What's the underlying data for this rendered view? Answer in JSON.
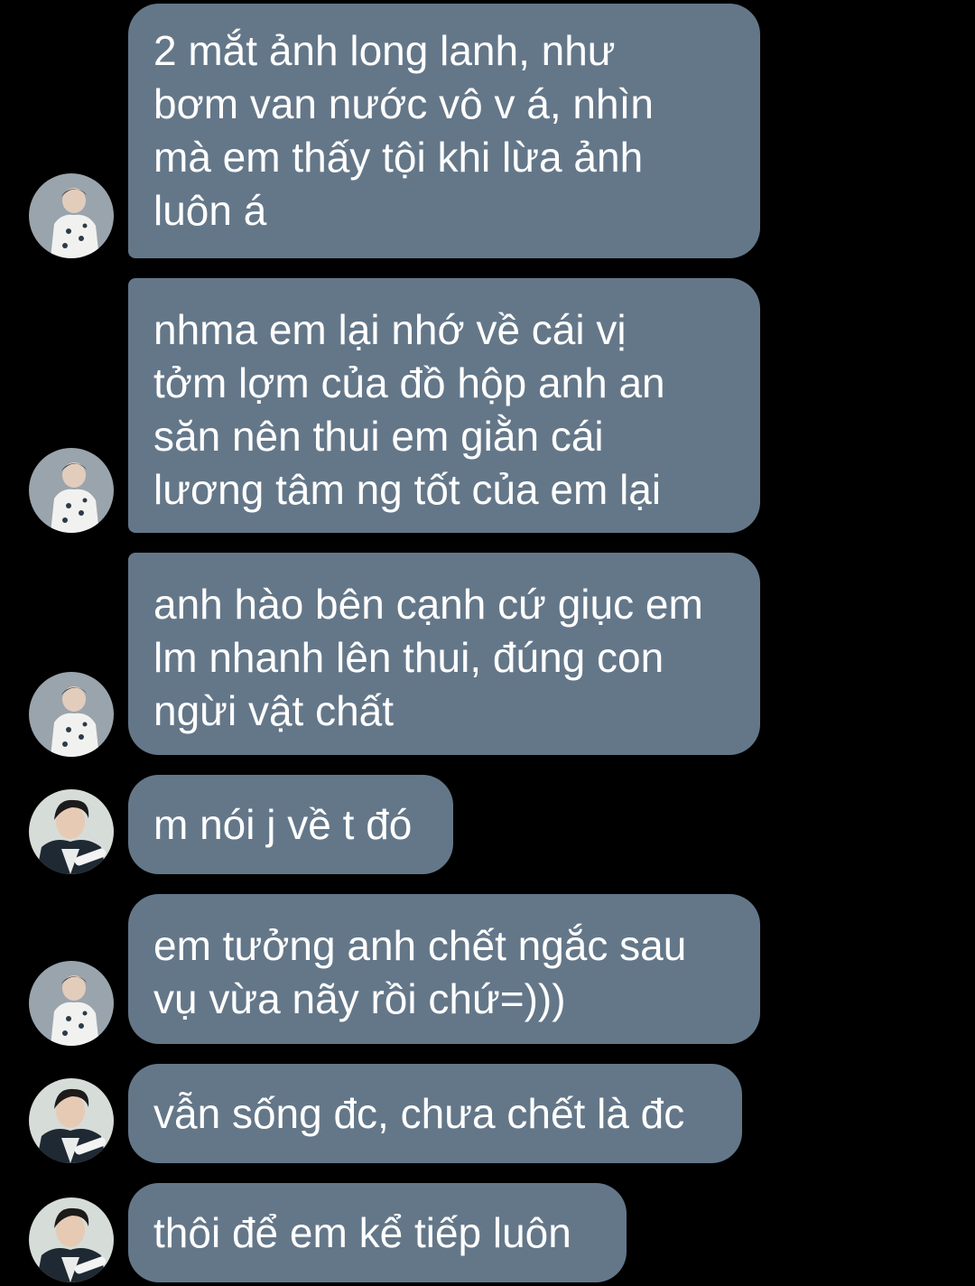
{
  "conversation": {
    "messages": [
      {
        "sender": "avatar-light",
        "text": "2 mắt ảnh long lanh, như\nbơm van nước vô v á, nhìn\nmà em thấy tội khi lừa ảnh\nluôn á"
      },
      {
        "sender": "avatar-light",
        "text": "nhma em lại nhớ về cái vị\ntởm lợm của đồ hộp anh an\nsăn nên thui em giằn cái\nlương tâm ng tốt của em lại"
      },
      {
        "sender": "avatar-light",
        "text": "anh hào bên cạnh cứ giục em\nlm nhanh lên thui, đúng con\nngừi vật chất"
      },
      {
        "sender": "avatar-dark",
        "text": "m nói j về t đó"
      },
      {
        "sender": "avatar-light",
        "text": "em tưởng anh chết ngắc sau\nvụ vừa nãy rồi chứ=)))"
      },
      {
        "sender": "avatar-dark",
        "text": "vẫn sống đc, chưa chết là đc"
      },
      {
        "sender": "avatar-dark",
        "text": "thôi để em kể tiếp luôn"
      }
    ]
  },
  "colors": {
    "background": "#000000",
    "bubble": "#647789",
    "text": "#ffffff"
  }
}
